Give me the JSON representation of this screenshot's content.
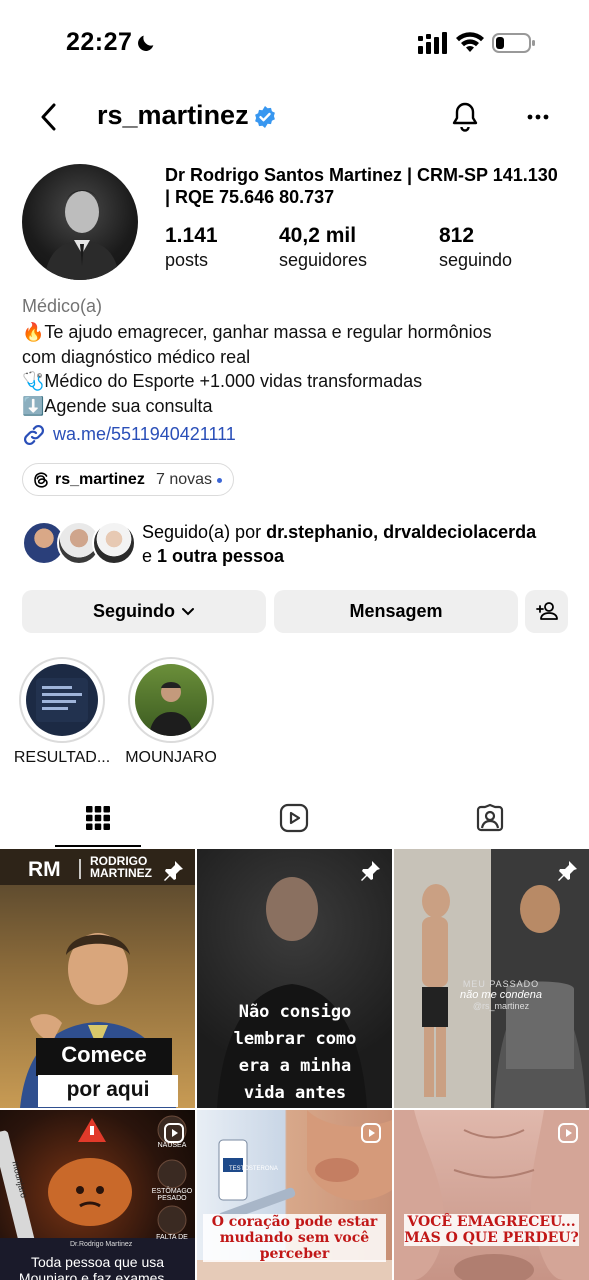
{
  "status_bar": {
    "time": "22:27"
  },
  "header": {
    "username": "rs_martinez",
    "icons": [
      "back-icon",
      "verified-badge-icon",
      "bell-icon",
      "more-icon"
    ]
  },
  "profile": {
    "full_name": "Dr Rodrigo Santos Martinez | CRM-SP 141.130 | RQE 75.646 80.737",
    "stats": [
      {
        "value": "1.141",
        "label": "posts"
      },
      {
        "value": "40,2 mil",
        "label": "seguidores"
      },
      {
        "value": "812",
        "label": "seguindo"
      }
    ],
    "category": "Médico(a)",
    "bio_lines": [
      "🔥Te ajudo emagrecer, ganhar massa e regular hormônios",
      "com diagnóstico médico real",
      "🩺Médico do Esporte +1.000 vidas transformadas",
      "⬇️Agende sua consulta"
    ],
    "link": "wa.me/5511940421111",
    "threads": {
      "username": "rs_martinez",
      "new_label": "7 novas"
    },
    "followed_by": {
      "prefix": "Seguido(a) por ",
      "names": "dr.stephanio, drvaldeciolacerda",
      "middle": "e ",
      "others": "1 outra pessoa"
    }
  },
  "actions": {
    "following_label": "Seguindo",
    "message_label": "Mensagem"
  },
  "highlights": [
    {
      "label": "RESULTAD..."
    },
    {
      "label": "MOUNJARO"
    }
  ],
  "tabs": [
    "grid-icon",
    "reels-icon",
    "tagged-icon"
  ],
  "posts": [
    {
      "brand": "RODRIGO MARTINEZ",
      "line1": "Comece",
      "line2": "por aqui",
      "pinned": true
    },
    {
      "text": "Não consigo lembrar como era a minha vida antes",
      "pinned": true
    },
    {
      "text_small": "MEU PASSADO",
      "text_main": "não me condena",
      "handle": "@rs_martinez",
      "pinned": true
    },
    {
      "caption_line1": "Toda pessoa que usa",
      "caption_line2": "Mounjaro e faz exames...",
      "labels": [
        "mounjaro",
        "NÁUSEA",
        "ESTÔMAGO PESADO",
        "FALTA DE"
      ],
      "author": "Dr.Rodrigo Martinez",
      "reel": true
    },
    {
      "caption": "O coração pode estar mudando sem você perceber",
      "label": "TESTOSTERONA",
      "reel": true
    },
    {
      "caption": "VOCÊ EMAGRECEU... MAS O QUE PERDEU?",
      "reel": true
    }
  ]
}
